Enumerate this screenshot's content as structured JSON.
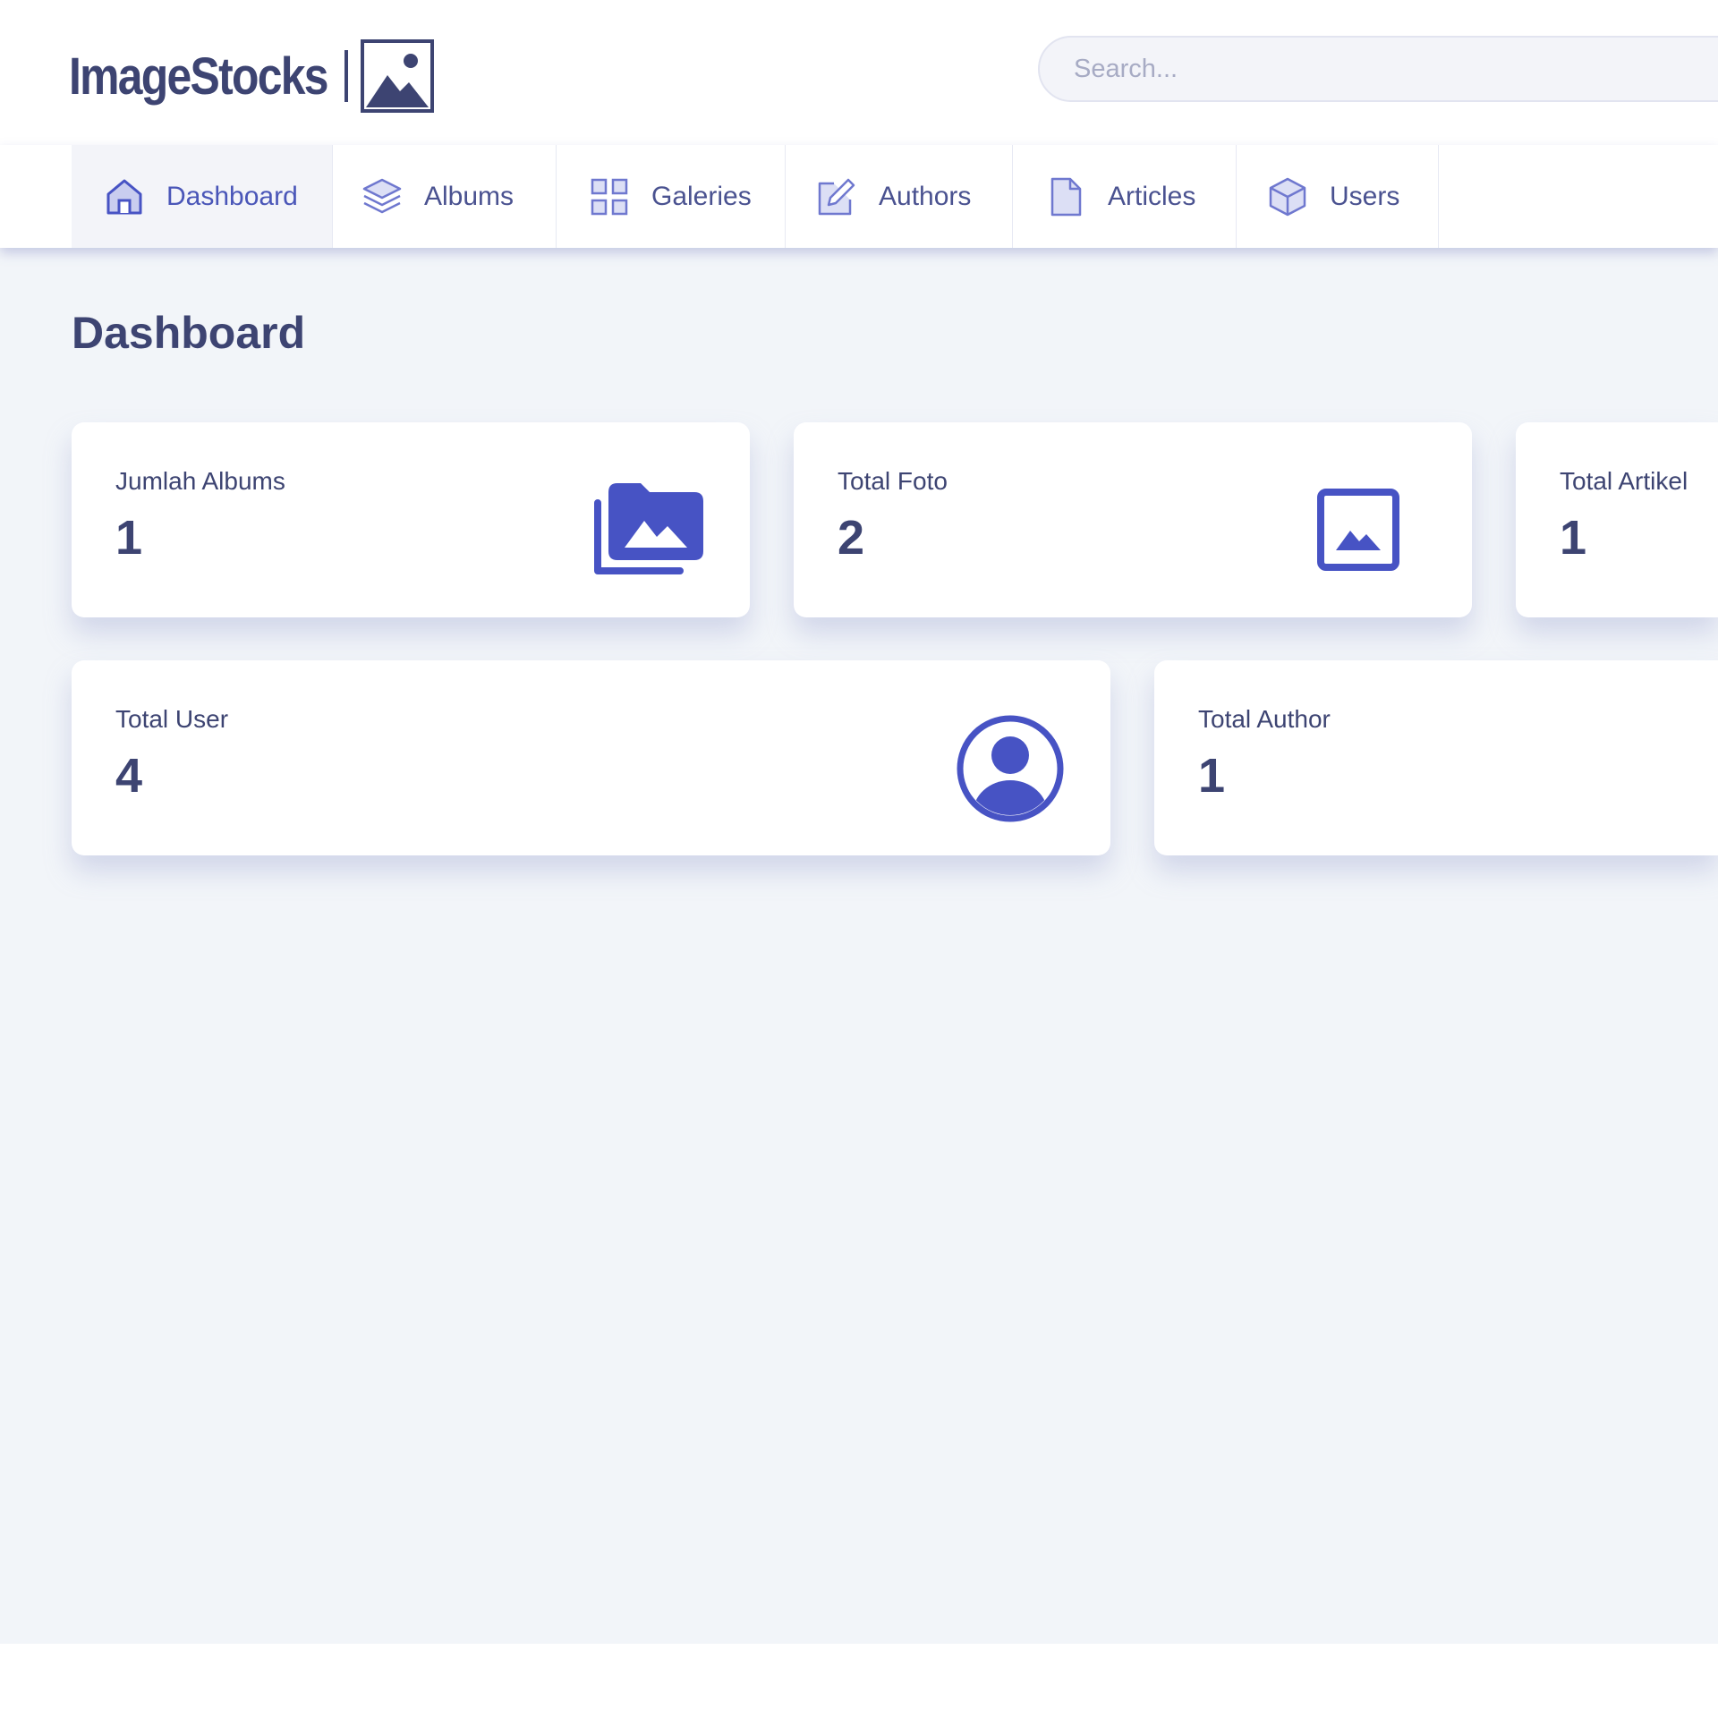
{
  "brand": {
    "name": "ImageStocks"
  },
  "search": {
    "placeholder": "Search..."
  },
  "nav": {
    "items": [
      {
        "label": "Dashboard",
        "icon": "home-icon",
        "active": true
      },
      {
        "label": "Albums",
        "icon": "layers-icon"
      },
      {
        "label": "Galeries",
        "icon": "grid-icon"
      },
      {
        "label": "Authors",
        "icon": "edit-icon"
      },
      {
        "label": "Articles",
        "icon": "file-icon"
      },
      {
        "label": "Users",
        "icon": "box-icon"
      }
    ]
  },
  "page": {
    "title": "Dashboard"
  },
  "stats": [
    {
      "label": "Jumlah Albums",
      "value": "1",
      "icon": "photo-albums-icon"
    },
    {
      "label": "Total Foto",
      "value": "2",
      "icon": "image-icon"
    },
    {
      "label": "Total Artikel",
      "value": "1"
    },
    {
      "label": "Total User",
      "value": "4",
      "icon": "user-circle-icon"
    },
    {
      "label": "Total Author",
      "value": "1"
    }
  ],
  "colors": {
    "accent": "#4753c4",
    "text": "#3d4472",
    "background": "#f2f5f9",
    "nav_active_bg": "#f3f4f9"
  }
}
